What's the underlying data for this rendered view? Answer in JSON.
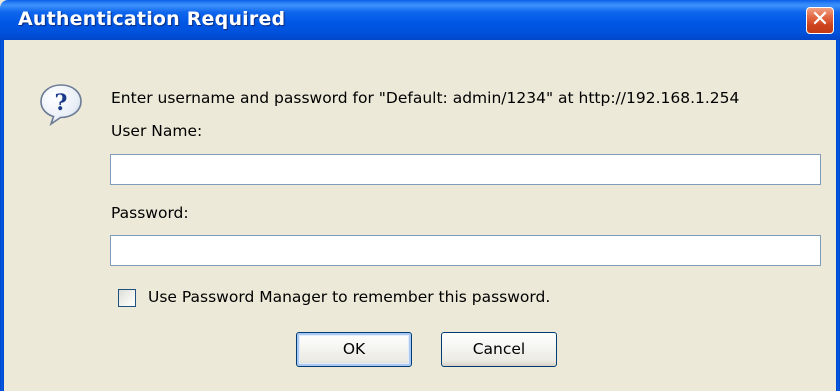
{
  "window": {
    "title": "Authentication Required",
    "close_glyph": "✕",
    "close_icon": "close-icon"
  },
  "dialog": {
    "icon": "question-mark-speech-bubble-icon",
    "prompt": "Enter username and password for \"Default: admin/1234\" at http://192.168.1.254",
    "username_label": "User Name:",
    "username_value": "",
    "password_label": "Password:",
    "password_value": "",
    "remember_label": "Use Password Manager to remember this password.",
    "remember_checked": false
  },
  "buttons": {
    "ok_label": "OK",
    "cancel_label": "Cancel"
  },
  "colors": {
    "titlebar": "#0058e6",
    "window_bg": "#ece9d8",
    "close_button": "#e26a45",
    "input_border": "#7f9db9",
    "button_border": "#003c74"
  }
}
